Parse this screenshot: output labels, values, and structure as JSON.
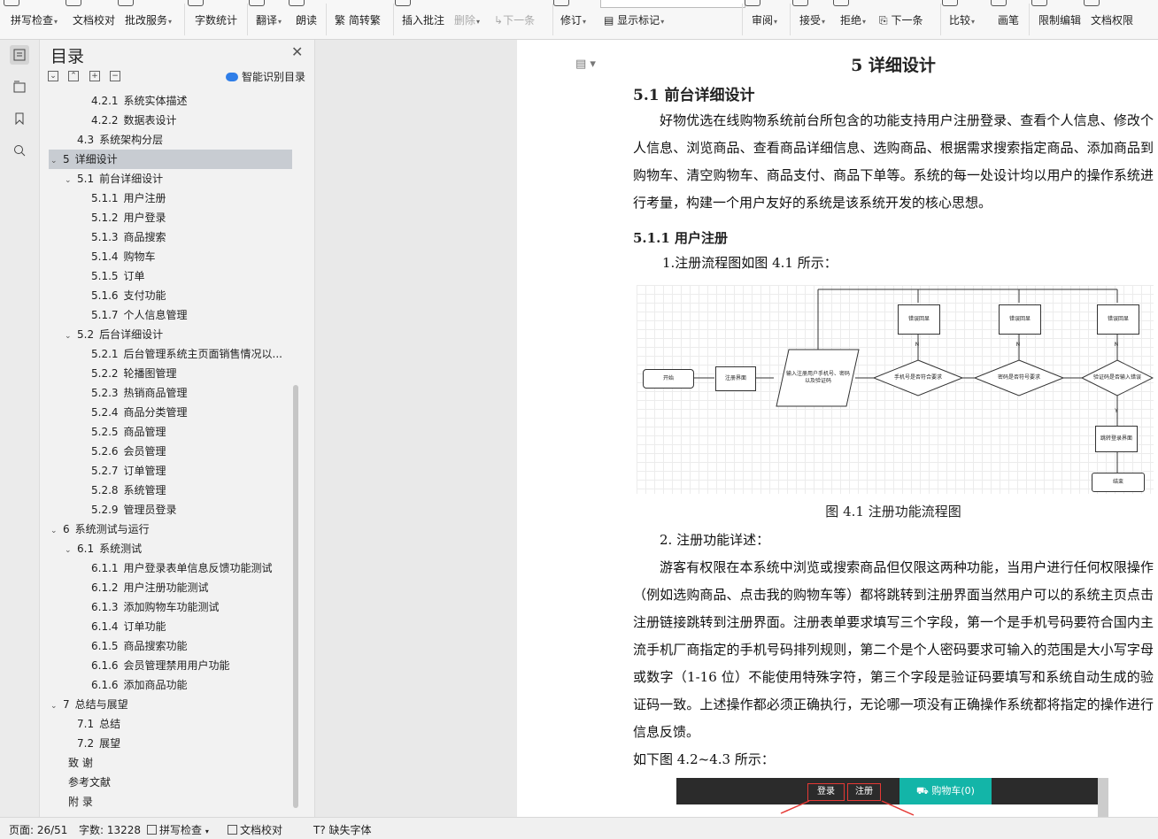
{
  "ribbon": {
    "spell_check": "拼写检查",
    "doc_proof": "文档校对",
    "review_service": "批改服务",
    "word_count": "字数统计",
    "translate": "翻译",
    "read_aloud": "朗读",
    "simp_trad": "简转繁",
    "insert_comment": "插入批注",
    "delete": "删除",
    "next_comment": "下一条",
    "track_changes": "修订",
    "show_markup": "显示标记",
    "review": "审阅",
    "accept": "接受",
    "reject": "拒绝",
    "next_change": "下一条",
    "compare": "比较",
    "pen": "画笔",
    "restrict_edit": "限制编辑",
    "doc_permission": "文档权限"
  },
  "toc": {
    "title": "目录",
    "smart_label": "智能识别目录",
    "items": [
      {
        "num": "4.2.1",
        "label": "系统实体描述"
      },
      {
        "num": "4.2.2",
        "label": "数据表设计"
      },
      {
        "num": "4.3",
        "label": "系统架构分层"
      },
      {
        "num": "5",
        "label": "详细设计"
      },
      {
        "num": "5.1",
        "label": "前台详细设计"
      },
      {
        "num": "5.1.1",
        "label": "用户注册"
      },
      {
        "num": "5.1.2",
        "label": "用户登录"
      },
      {
        "num": "5.1.3",
        "label": "商品搜索"
      },
      {
        "num": "5.1.4",
        "label": "购物车"
      },
      {
        "num": "5.1.5",
        "label": "订单"
      },
      {
        "num": "5.1.6",
        "label": "支付功能"
      },
      {
        "num": "5.1.7",
        "label": "个人信息管理"
      },
      {
        "num": "5.2",
        "label": "后台详细设计"
      },
      {
        "num": "5.2.1",
        "label": "后台管理系统主页面销售情况以..."
      },
      {
        "num": "5.2.2",
        "label": "轮播图管理"
      },
      {
        "num": "5.2.3",
        "label": "热销商品管理"
      },
      {
        "num": "5.2.4",
        "label": "商品分类管理"
      },
      {
        "num": "5.2.5",
        "label": "商品管理"
      },
      {
        "num": "5.2.6",
        "label": "会员管理"
      },
      {
        "num": "5.2.7",
        "label": "订单管理"
      },
      {
        "num": "5.2.8",
        "label": "系统管理"
      },
      {
        "num": "5.2.9",
        "label": "管理员登录"
      },
      {
        "num": "6",
        "label": "系统测试与运行"
      },
      {
        "num": "6.1",
        "label": "系统测试"
      },
      {
        "num": "6.1.1",
        "label": "用户登录表单信息反馈功能测试"
      },
      {
        "num": "6.1.2",
        "label": "用户注册功能测试"
      },
      {
        "num": "6.1.3",
        "label": "添加购物车功能测试"
      },
      {
        "num": "6.1.4",
        "label": "订单功能"
      },
      {
        "num": "6.1.5",
        "label": "商品搜索功能"
      },
      {
        "num": "6.1.6",
        "label": "会员管理禁用用户功能"
      },
      {
        "num": "6.1.6",
        "label": "添加商品功能"
      },
      {
        "num": "7",
        "label": "总结与展望"
      },
      {
        "num": "7.1",
        "label": "总结"
      },
      {
        "num": "7.2",
        "label": "展望"
      },
      {
        "num": "",
        "label": "致 谢"
      },
      {
        "num": "",
        "label": "参考文献"
      },
      {
        "num": "",
        "label": "附 录"
      }
    ]
  },
  "doc": {
    "chapter_title": "5  详细设计",
    "section_title": "5.1  前台详细设计",
    "para1": "好物优选在线购物系统前台所包含的功能支持用户注册登录、查看个人信息、修改个人信息、浏览商品、查看商品详细信息、选购商品、根据需求搜索指定商品、添加商品到购物车、清空购物车、商品支付、商品下单等。系统的每一处设计均以用户的操作系统进行考量，构建一个用户友好的系统是该系统开发的核心思想。",
    "subsection_title": "5.1.1  用户注册",
    "step1": "1.注册流程图如图 4.1 所示：",
    "figure_caption": "图 4.1  注册功能流程图",
    "step2": "2. 注册功能详述：",
    "para2": "游客有权限在本系统中浏览或搜索商品但仅限这两种功能，当用户进行任何权限操作（例如选购商品、点击我的购物车等）都将跳转到注册界面当然用户可以的系统主页点击注册链接跳转到注册界面。注册表单要求填写三个字段，第一个是手机号码要符合国内主流手机厂商指定的手机号码排列规则，第二个是个人密码要求可输入的范围是大小写字母或数字（1-16 位）不能使用特殊字符，第三个字段是验证码要填写和系统自动生成的验证码一致。上述操作都必须正确执行，无论哪一项没有正确操作系统都将指定的操作进行信息反馈。",
    "para3": "如下图 4.2~4.3 所示：",
    "flow": {
      "start": "开始",
      "register_page": "注册界面",
      "input": "输入注册用户手机号、密码以及验证码",
      "check_phone": "手机号是否符合要求",
      "check_pwd": "密码是否符号要求",
      "check_code": "验证码是否输入错误",
      "err1": "错误回显",
      "err2": "错误回显",
      "err3": "错误回显",
      "goto_login": "跳转登录界面",
      "end": "结束",
      "n": "N",
      "y": "Y"
    },
    "shot": {
      "login": "登录",
      "register": "注册",
      "cart": "购物车(0)"
    }
  },
  "status": {
    "page": "页面: 26/51",
    "words": "字数: 13228",
    "spell": "拼写检查",
    "proof": "文档校对",
    "missing_font": "缺失字体"
  }
}
